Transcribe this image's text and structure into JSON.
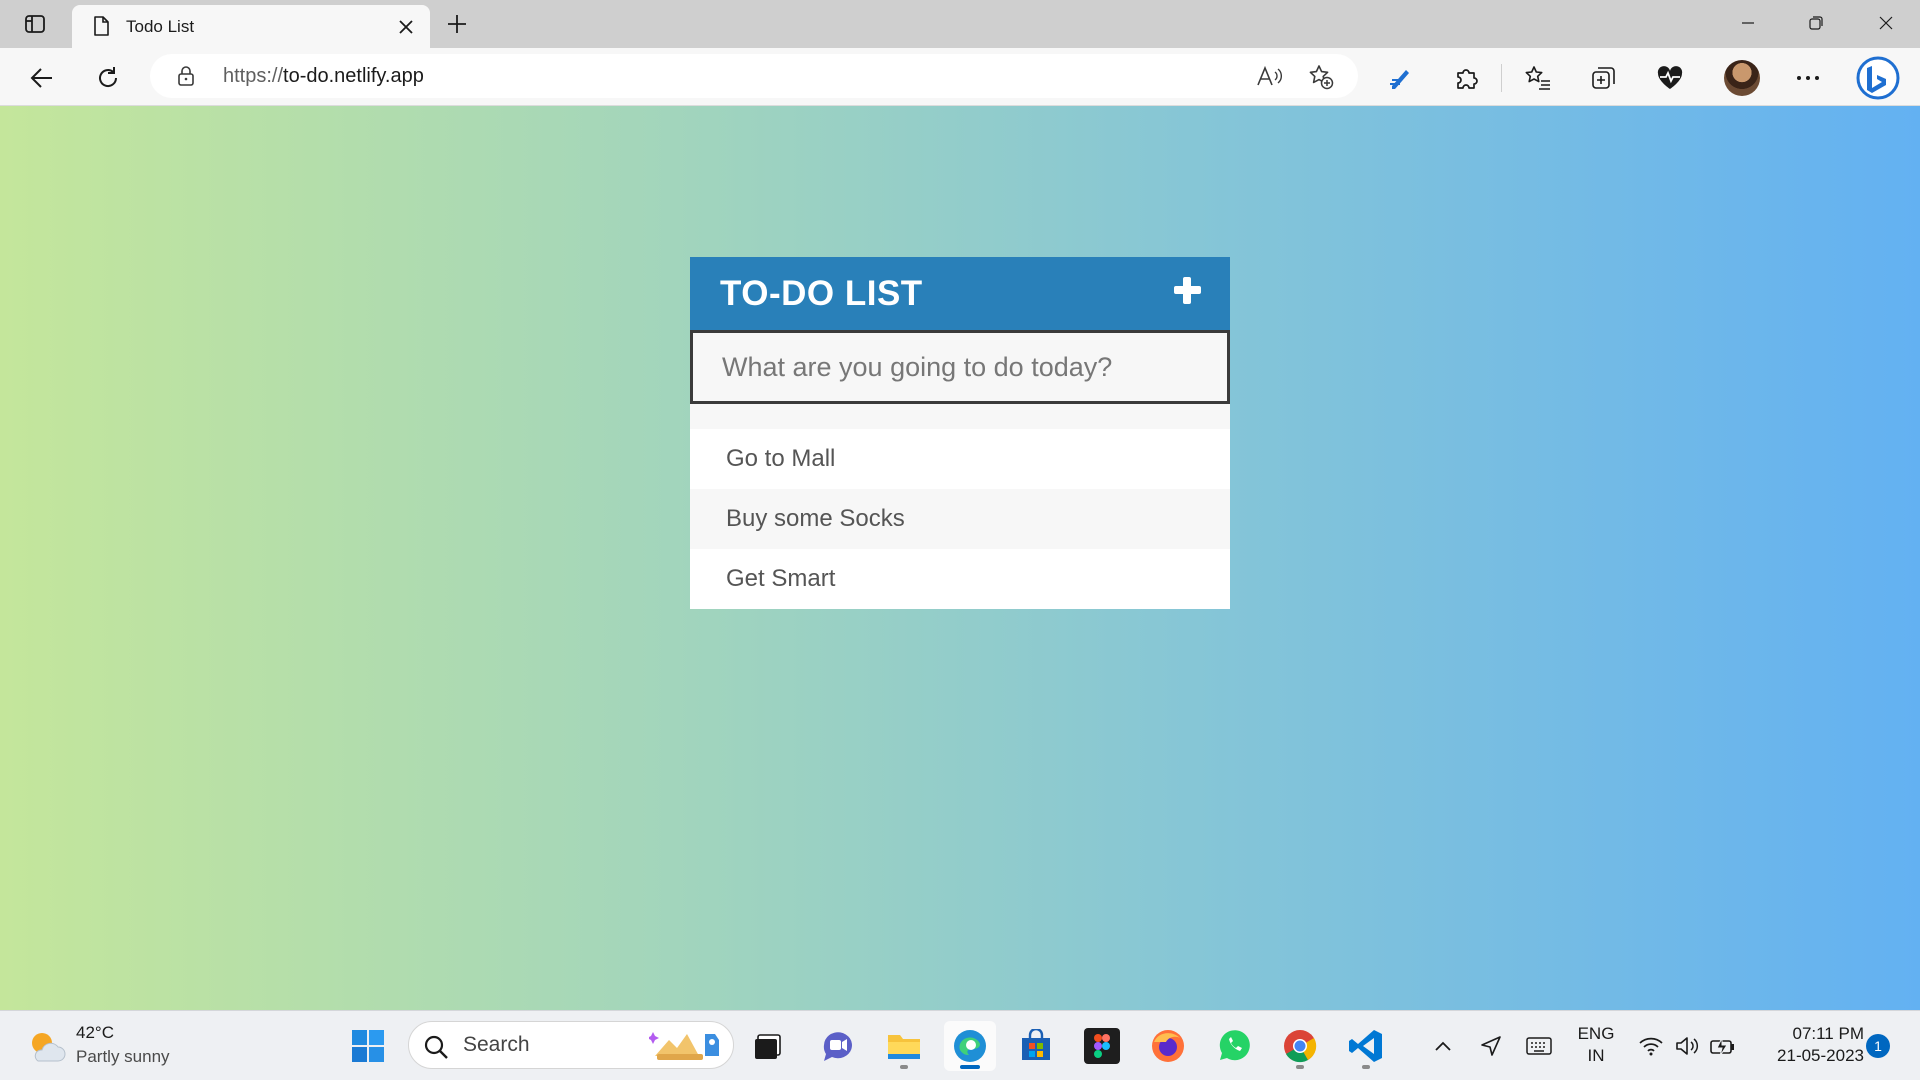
{
  "browser": {
    "tab_title": "Todo List",
    "url_scheme": "https://",
    "url_host": "to-do.netlify.app"
  },
  "app": {
    "title": "TO-DO LIST",
    "input_placeholder": "What are you going to do today?",
    "todos": [
      "Go to Mall",
      "Buy some Socks",
      "Get Smart"
    ],
    "accent_color": "#2980b9",
    "background_gradient": [
      "#c4e69b",
      "#a2d5bc",
      "#86c6d6",
      "#63b1f2"
    ]
  },
  "taskbar": {
    "weather_temp": "42°C",
    "weather_desc": "Partly sunny",
    "search_label": "Search",
    "pinned_apps": [
      "start-icon",
      "search",
      "task-view-icon",
      "teams-chat-icon",
      "file-explorer-icon",
      "edge-icon",
      "microsoft-store-icon",
      "figma-icon",
      "firefox-icon",
      "whatsapp-icon",
      "chrome-icon",
      "vscode-icon"
    ],
    "lang_line1": "ENG",
    "lang_line2": "IN",
    "time": "07:11 PM",
    "date": "21-05-2023",
    "notification_count": "1"
  }
}
